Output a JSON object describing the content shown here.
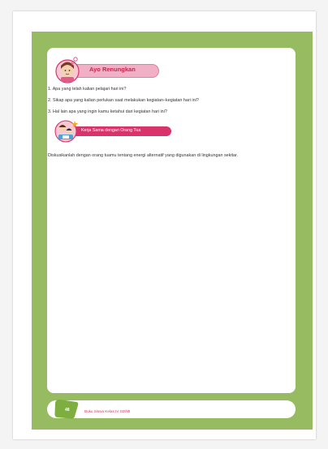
{
  "section_reflect": {
    "title": "Ayo Renungkan",
    "questions": [
      "1. Apa yang telah kalian pelajari hari ini?",
      "2. Sikap apa yang kalian perlukan saat melakukan kegiatan–kegiatan hari ini?",
      "3. Hal lain apa yang ingin kamu ketahui dari kegiatan hari ini?"
    ]
  },
  "section_parents": {
    "title": "Kerja Sama dengan Orang Tua",
    "text": "Diskusikanlah dengan orang tuamu tentang energi alternatif yang digunakan di lingkungan sekitar."
  },
  "footer": {
    "page_number": "48",
    "book_title": "Buku Siswa Kelas IV SD/MI"
  },
  "colors": {
    "frame_green": "#97bb60",
    "pink_pill": "#f1b0c5",
    "magenta_pill": "#d9336c",
    "title_red": "#c8244e"
  },
  "icons": {
    "reflect": "girl-thinking-illustration",
    "parents": "parent-child-illustration",
    "page_badge": "green-page-tab"
  }
}
